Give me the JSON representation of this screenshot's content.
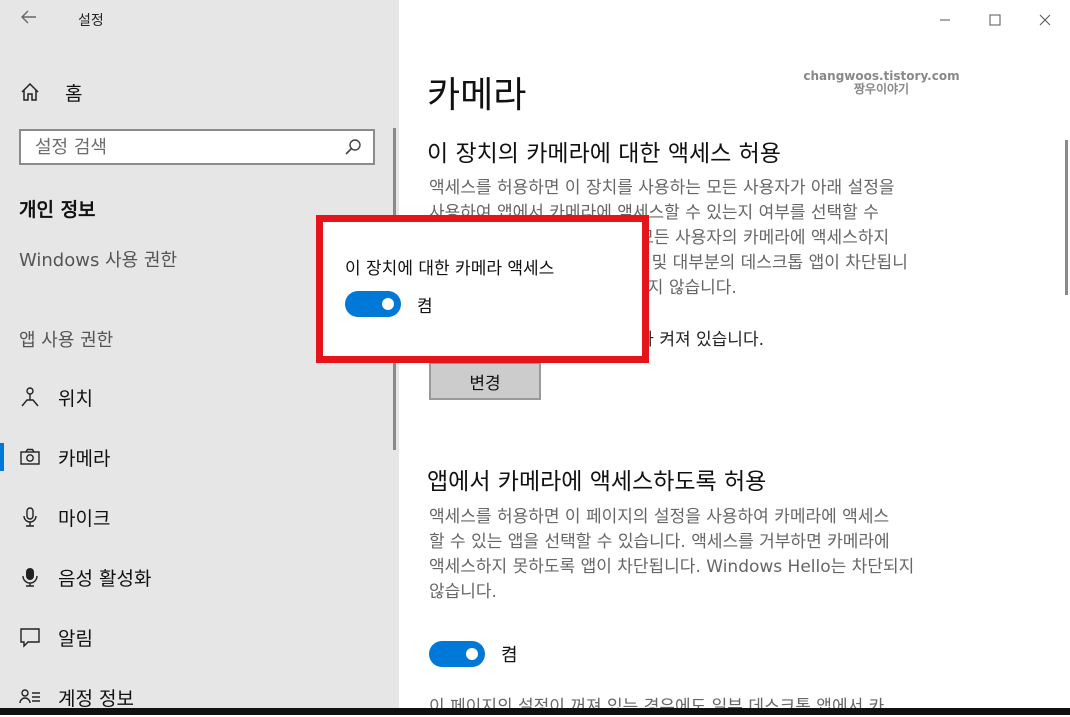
{
  "window": {
    "title": "설정"
  },
  "sidebar": {
    "home_label": "홈",
    "search_placeholder": "설정 검색",
    "section_heading": "개인 정보",
    "group1_label": "Windows 사용 권한",
    "group2_label": "앱 사용 권한",
    "items": [
      {
        "label": "위치",
        "icon": "location-icon"
      },
      {
        "label": "카메라",
        "icon": "camera-icon",
        "active": true
      },
      {
        "label": "마이크",
        "icon": "microphone-icon"
      },
      {
        "label": "음성 활성화",
        "icon": "voice-activation-icon"
      },
      {
        "label": "알림",
        "icon": "notification-icon"
      },
      {
        "label": "계정 정보",
        "icon": "account-info-icon"
      }
    ]
  },
  "watermark": {
    "line1": "changwoos.tistory.com",
    "line2": "짱우이야기"
  },
  "main": {
    "page_title": "카메라",
    "section1": {
      "title": "이 장치의 카메라에 대한 액세스 허용",
      "lines": [
        "액세스를 허용하면 이 장치를 사용하는 모든 사용자가 아래 설정을",
        "사용하여 앱에서 카메라에 액세스할 수 있는지 여부를 선택할 수",
        "있습니다. 액세스를 거부하면 모든 사용자의 카메라에 액세스하지",
        "못하도록 Windows 스토어 앱 및 대부분의 데스크톱 앱이 차단됩니",
        "다. Windows Hello는 차단되지 않습니다."
      ],
      "status": "이 장치에 대한 카메라 액세스가 켜져 있습니다.",
      "change_button": "변경"
    },
    "section2": {
      "title": "앱에서 카메라에 액세스하도록 허용",
      "lines": [
        "액세스를 허용하면 이 페이지의 설정을 사용하여 카메라에 액세스",
        "할 수 있는 앱을 선택할 수 있습니다. 액세스를 거부하면 카메라에",
        "액세스하지 못하도록 앱이 차단됩니다. Windows Hello는 차단되지",
        "않습니다."
      ],
      "toggle_state": "켬",
      "cut_text": "이 페이지의 설정이 꺼져 있는 경우에도 일부 데스크톱 앱에서 카"
    }
  },
  "popup": {
    "title": "이 장치에 대한 카메라 액세스",
    "toggle_state": "켬"
  },
  "colors": {
    "accent": "#0078d7",
    "highlight": "#e5141b",
    "sidebar_bg": "#e6e6e6"
  }
}
